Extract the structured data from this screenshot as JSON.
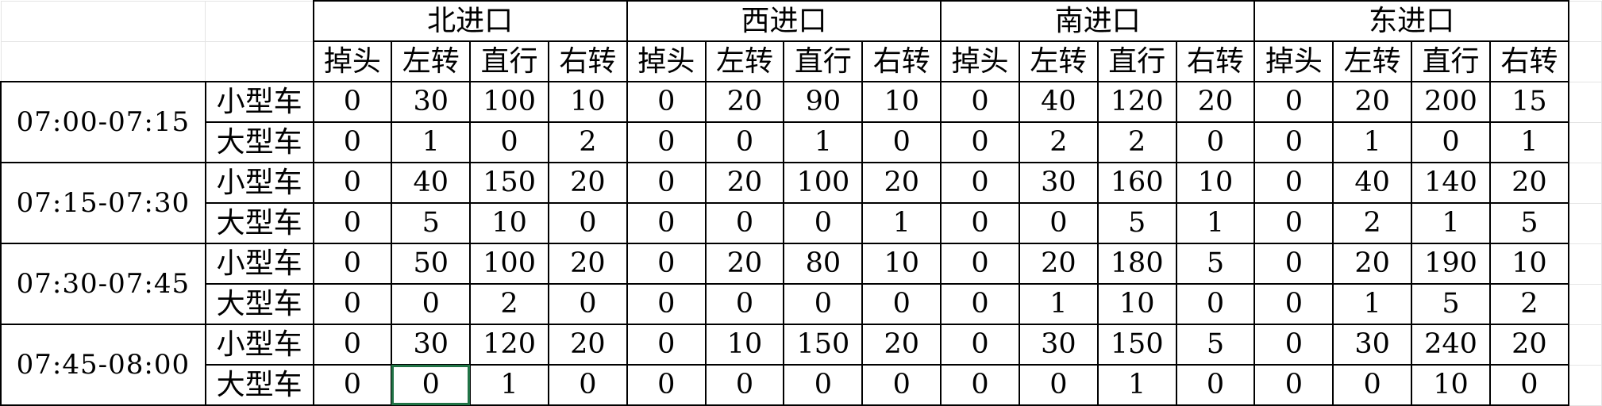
{
  "approaches": [
    "北进口",
    "西进口",
    "南进口",
    "东进口"
  ],
  "movements": [
    "掉头",
    "左转",
    "直行",
    "右转"
  ],
  "vehicle_types": [
    "小型车",
    "大型车"
  ],
  "periods": [
    {
      "time": "07:00-07:15",
      "rows": [
        [
          0,
          30,
          100,
          10,
          0,
          20,
          90,
          10,
          0,
          40,
          120,
          20,
          0,
          20,
          200,
          15
        ],
        [
          0,
          1,
          0,
          2,
          0,
          0,
          1,
          0,
          0,
          2,
          2,
          0,
          0,
          1,
          0,
          1
        ]
      ]
    },
    {
      "time": "07:15-07:30",
      "rows": [
        [
          0,
          40,
          150,
          20,
          0,
          20,
          100,
          20,
          0,
          30,
          160,
          10,
          0,
          40,
          140,
          20
        ],
        [
          0,
          5,
          10,
          0,
          0,
          0,
          0,
          1,
          0,
          0,
          5,
          1,
          0,
          2,
          1,
          5
        ]
      ]
    },
    {
      "time": "07:30-07:45",
      "rows": [
        [
          0,
          50,
          100,
          20,
          0,
          20,
          80,
          10,
          0,
          20,
          180,
          5,
          0,
          20,
          190,
          10
        ],
        [
          0,
          0,
          2,
          0,
          0,
          0,
          0,
          0,
          0,
          1,
          10,
          0,
          0,
          1,
          5,
          2
        ]
      ]
    },
    {
      "time": "07:45-08:00",
      "rows": [
        [
          0,
          30,
          120,
          20,
          0,
          10,
          150,
          20,
          0,
          30,
          150,
          5,
          0,
          30,
          240,
          20
        ],
        [
          0,
          0,
          1,
          0,
          0,
          0,
          0,
          0,
          0,
          0,
          1,
          0,
          0,
          0,
          10,
          0
        ]
      ]
    }
  ],
  "selected_cell": {
    "period": 3,
    "row": 1,
    "col": 1
  },
  "colors": {
    "selection": "#217346",
    "gridline": "#e0e0e0",
    "border": "#000000"
  }
}
